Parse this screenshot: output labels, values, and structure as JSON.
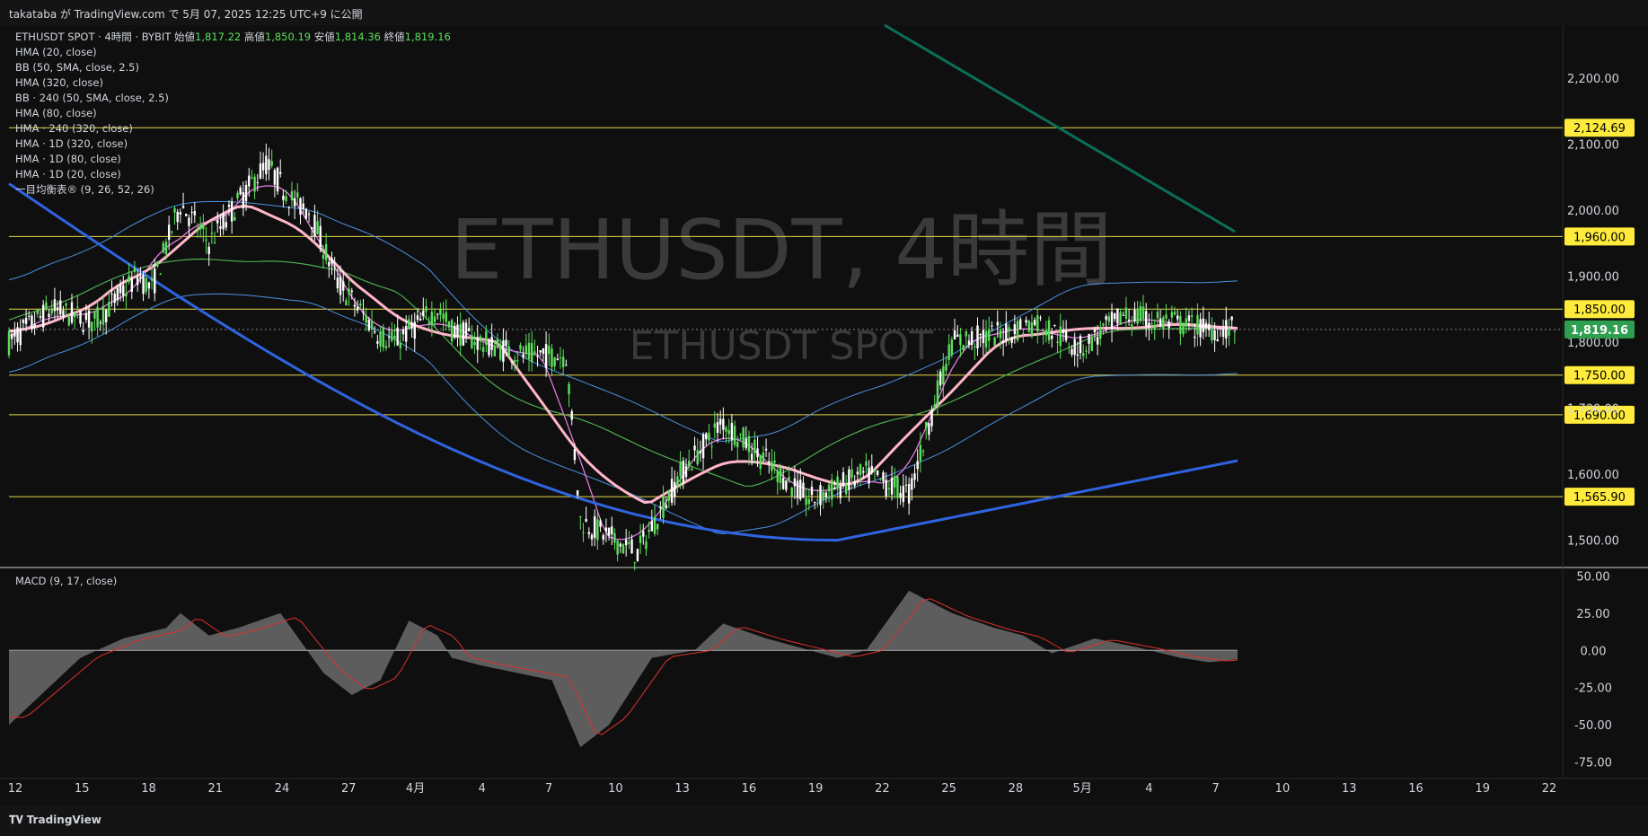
{
  "header": {
    "publish_text": "takataba が TradingView.com で 5月 07, 2025 12:25 UTC+9 に公開"
  },
  "legend": {
    "symbol": "ETHUSDT SPOT · 4時間 · BYBIT",
    "open_label": "始値",
    "open": "1,817.22",
    "high_label": "高値",
    "high": "1,850.19",
    "low_label": "安値",
    "low": "1,814.36",
    "close_label": "終値",
    "close": "1,819.16",
    "indicators": [
      "HMA (20, close)",
      "BB (50, SMA, close, 2.5)",
      "HMA (320, close)",
      "BB · 240 (50, SMA, close, 2.5)",
      "HMA (80, close)",
      "HMA · 240 (320, close)",
      "HMA · 1D (320, close)",
      "HMA · 1D (80, close)",
      "HMA · 1D (20, close)",
      "一目均衡表® (9, 26, 52, 26)"
    ]
  },
  "watermark": {
    "line1": "ETHUSDT, 4時間",
    "line2": "ETHUSDT SPOT"
  },
  "macd": {
    "label": "MACD (9, 17, close)"
  },
  "footer": {
    "brand": "TradingView"
  },
  "colors": {
    "bg": "#0f0f0f",
    "up": "#5be05b",
    "down": "#ffffff",
    "hma20": "#e07ce0",
    "hma80": "#ffb6c8",
    "hma320": "#2f64e0",
    "bb": "#4a90e2",
    "green_line": "#4caf50",
    "teal_line": "#0b6e59",
    "hline": "#e6d84a",
    "macd_hist": "#6b6b6b",
    "signal": "#e03030"
  },
  "chart_data": {
    "type": "candlestick",
    "price_axis": {
      "labels": [
        "2,200.00",
        "2,100.00",
        "2,000.00",
        "1,900.00",
        "1,800.00",
        "1,700.00",
        "1,600.00",
        "1,500.00"
      ],
      "ylim": [
        1460,
        2280
      ]
    },
    "horizontal_levels": [
      {
        "value": 2124.69,
        "label": "2,124.69"
      },
      {
        "value": 1960.0,
        "label": "1,960.00"
      },
      {
        "value": 1850.0,
        "label": "1,850.00"
      },
      {
        "value": 1750.0,
        "label": "1,750.00"
      },
      {
        "value": 1690.0,
        "label": "1,690.00"
      },
      {
        "value": 1565.9,
        "label": "1,565.90"
      }
    ],
    "last_price": {
      "value": 1819.16,
      "label": "1,819.16"
    },
    "macd_axis": {
      "labels": [
        "50.00",
        "25.00",
        "0.00",
        "-25.00",
        "-50.00",
        "-75.00"
      ],
      "ylim": [
        -80,
        55
      ]
    },
    "x_labels": [
      "12",
      "15",
      "18",
      "21",
      "24",
      "27",
      "4月",
      "4",
      "7",
      "10",
      "13",
      "16",
      "19",
      "22",
      "25",
      "28",
      "5月",
      "4",
      "7",
      "10",
      "13",
      "16",
      "19",
      "22"
    ],
    "price_path_anchors": [
      [
        0,
        1800
      ],
      [
        3,
        1850
      ],
      [
        6,
        1830
      ],
      [
        9,
        1900
      ],
      [
        10,
        1880
      ],
      [
        12,
        2010
      ],
      [
        14,
        1950
      ],
      [
        18,
        2070
      ],
      [
        20,
        2010
      ],
      [
        21,
        2000
      ],
      [
        23,
        1890
      ],
      [
        26,
        1810
      ],
      [
        27,
        1800
      ],
      [
        30,
        1850
      ],
      [
        31,
        1820
      ],
      [
        33,
        1800
      ],
      [
        36,
        1780
      ],
      [
        39,
        1780
      ],
      [
        40,
        1530
      ],
      [
        44,
        1480
      ],
      [
        47,
        1600
      ],
      [
        50,
        1680
      ],
      [
        53,
        1620
      ],
      [
        56,
        1560
      ],
      [
        60,
        1600
      ],
      [
        63,
        1570
      ],
      [
        66,
        1800
      ],
      [
        69,
        1810
      ],
      [
        72,
        1830
      ],
      [
        75,
        1790
      ],
      [
        78,
        1840
      ],
      [
        81,
        1830
      ],
      [
        84,
        1820
      ],
      [
        86,
        1819
      ]
    ],
    "macd_hist_anchors": [
      [
        0,
        -50
      ],
      [
        5,
        -5
      ],
      [
        8,
        8
      ],
      [
        11,
        15
      ],
      [
        12,
        25
      ],
      [
        14,
        10
      ],
      [
        16,
        15
      ],
      [
        19,
        25
      ],
      [
        22,
        -15
      ],
      [
        24,
        -30
      ],
      [
        26,
        -20
      ],
      [
        28,
        20
      ],
      [
        30,
        10
      ],
      [
        31,
        -5
      ],
      [
        33,
        -10
      ],
      [
        38,
        -20
      ],
      [
        40,
        -65
      ],
      [
        42,
        -50
      ],
      [
        45,
        -5
      ],
      [
        48,
        0
      ],
      [
        50,
        18
      ],
      [
        53,
        8
      ],
      [
        58,
        -5
      ],
      [
        60,
        0
      ],
      [
        63,
        40
      ],
      [
        66,
        25
      ],
      [
        69,
        15
      ],
      [
        71,
        10
      ],
      [
        73,
        -2
      ],
      [
        76,
        8
      ],
      [
        79,
        2
      ],
      [
        82,
        -5
      ],
      [
        84,
        -8
      ],
      [
        86,
        -6
      ]
    ]
  }
}
